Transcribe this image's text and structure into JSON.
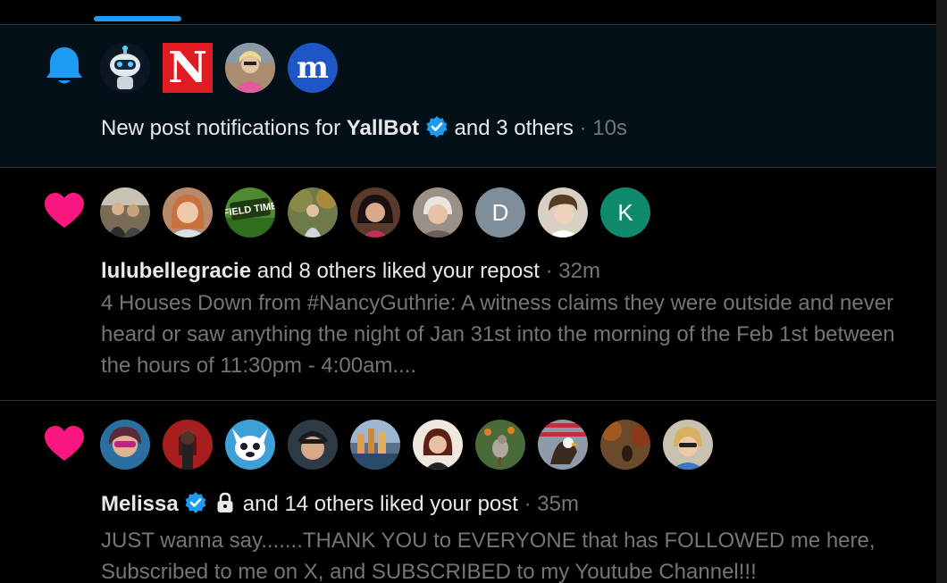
{
  "notifications": [
    {
      "type": "new-post",
      "user": "YallBot",
      "verified": true,
      "rest": "and 3 others",
      "prefix": "New post notifications for",
      "time": "· 10s",
      "avatars": [
        "robot-avatar",
        "n-logo-avatar",
        "photo-avatar",
        "m-logo-avatar"
      ],
      "logo_letters": {
        "n": "N",
        "m": "m"
      }
    },
    {
      "type": "like",
      "user": "lulubellegracie",
      "rest": "and 8 others liked your repost",
      "time": "· 32m",
      "snippet": "4 Houses Down from #NancyGuthrie: A witness claims they were outside and never heard or saw anything the night of Jan 31st into the morning of the Feb 1st between the hours of 11:30pm - 4:00am....",
      "initials": {
        "d": "D",
        "k": "K"
      },
      "field_time_text": "FIELD TIME",
      "avatar_colors": [
        "#7a6b55",
        "#b98a6a",
        "#4e8a32",
        "#6e7a4a",
        "#5a3a2a",
        "#9a9088",
        "#7e8e9b",
        "#d8d0c2",
        "#0f8a6d"
      ]
    },
    {
      "type": "like",
      "user": "Melissa",
      "verified": true,
      "locked": true,
      "rest": "and 14 others liked your post",
      "time": "· 35m",
      "snippet": "JUST wanna say.......THANK YOU to EVERYONE that has FOLLOWED me here, Subscribed to me on X, and SUBSCRIBED to my Youtube Channel!!!",
      "avatar_colors": [
        "#2a6fa0",
        "#a81e1e",
        "#3fa0d8",
        "#2e3a46",
        "#5b6f8a",
        "#efe8df",
        "#4a6a3a",
        "#8f9aa8",
        "#6a4a2a",
        "#c9c2b0"
      ]
    }
  ],
  "colors": {
    "accent": "#1d9bf0",
    "heart": "#f91880",
    "unread_bg": "#031018",
    "muted": "#71767b"
  }
}
